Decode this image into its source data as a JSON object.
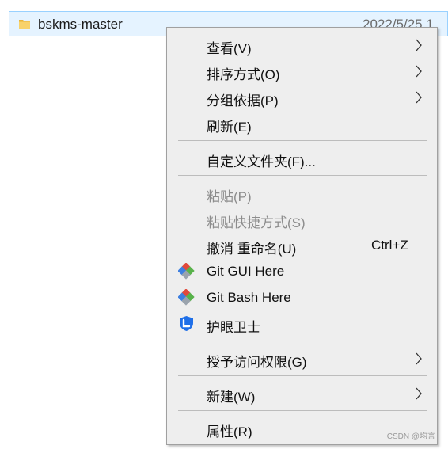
{
  "explorer": {
    "file_name": "bskms-master",
    "file_date": "2022/5/25 1"
  },
  "context_menu": {
    "items": [
      {
        "label": "查看(V)",
        "submenu": true
      },
      {
        "label": "排序方式(O)",
        "submenu": true
      },
      {
        "label": "分组依据(P)",
        "submenu": true
      },
      {
        "label": "刷新(E)"
      },
      {
        "label": "自定义文件夹(F)..."
      },
      {
        "label": "粘贴(P)",
        "disabled": true
      },
      {
        "label": "粘贴快捷方式(S)",
        "disabled": true
      },
      {
        "label": "撤消 重命名(U)",
        "shortcut": "Ctrl+Z"
      },
      {
        "label": "Git GUI Here",
        "icon": "git-gui-icon"
      },
      {
        "label": "Git Bash Here",
        "icon": "git-bash-icon"
      },
      {
        "label": "护眼卫士",
        "icon": "eye-guard-shield-icon"
      },
      {
        "label": "授予访问权限(G)",
        "submenu": true
      },
      {
        "label": "新建(W)",
        "submenu": true
      },
      {
        "label": "属性(R)"
      }
    ]
  },
  "watermark": "CSDN @均言",
  "colors": {
    "menu_background": "#eeeeee",
    "selection_fill": "#e5f3ff",
    "selection_border": "#99d1ff",
    "folder_yellow": "#f8d26a",
    "git_green": "#58b24a",
    "git_red": "#e2493a",
    "git_blue": "#3d7fe0",
    "shield_blue": "#1f6fe8"
  }
}
